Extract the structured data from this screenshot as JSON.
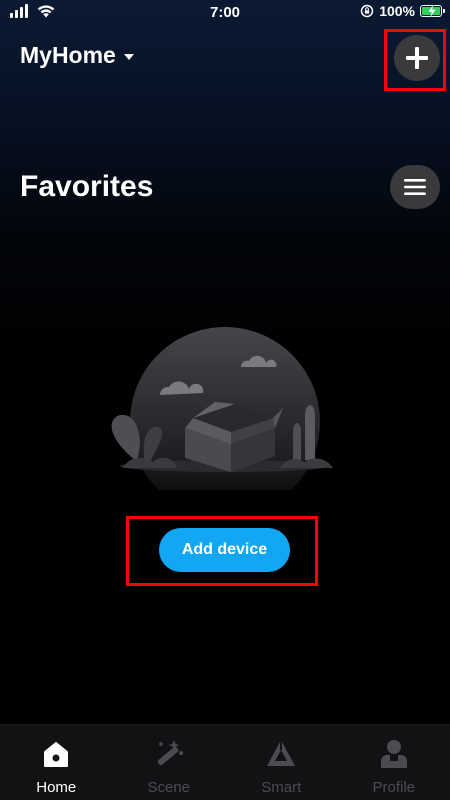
{
  "status_bar": {
    "time": "7:00",
    "battery_text": "100%"
  },
  "header": {
    "home_name": "MyHome",
    "add_icon": "plus-icon",
    "dropdown_icon": "caret-down-icon"
  },
  "favorites": {
    "title": "Favorites",
    "menu_icon": "hamburger-icon",
    "empty_illustration": "empty-box-illustration"
  },
  "add_device": {
    "label": "Add device",
    "color": "#11a7f3"
  },
  "nav": {
    "tabs": [
      {
        "label": "Home",
        "icon": "home-icon",
        "active": true
      },
      {
        "label": "Scene",
        "icon": "magic-wand-icon",
        "active": false
      },
      {
        "label": "Smart",
        "icon": "smart-triangle-icon",
        "active": false
      },
      {
        "label": "Profile",
        "icon": "profile-icon",
        "active": false
      }
    ]
  },
  "colors": {
    "highlight": "#ff0000",
    "battery": "#2fd158",
    "inactive_tab": "#4b4c50"
  }
}
